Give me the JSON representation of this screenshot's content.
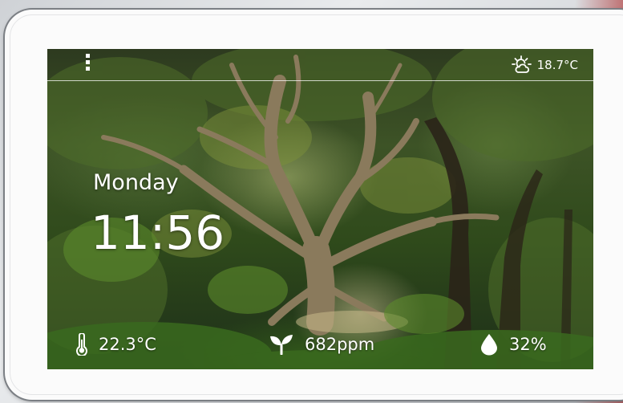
{
  "header": {
    "outdoor_temperature": "18.7°C",
    "weather_icon": "partly-cloudy-icon",
    "menu_icon": "menu-dots-icon"
  },
  "clock": {
    "day": "Monday",
    "time": "11:56"
  },
  "sensors": {
    "temperature": {
      "icon": "thermometer-icon",
      "value": "22.3°C"
    },
    "co2": {
      "icon": "leaf-sprout-icon",
      "value": "682ppm"
    },
    "humidity": {
      "icon": "water-drop-icon",
      "value": "32%"
    }
  },
  "colors": {
    "text": "#ffffff",
    "device_frame": "#fbfbfb",
    "background_foliage": "#3d5326"
  }
}
